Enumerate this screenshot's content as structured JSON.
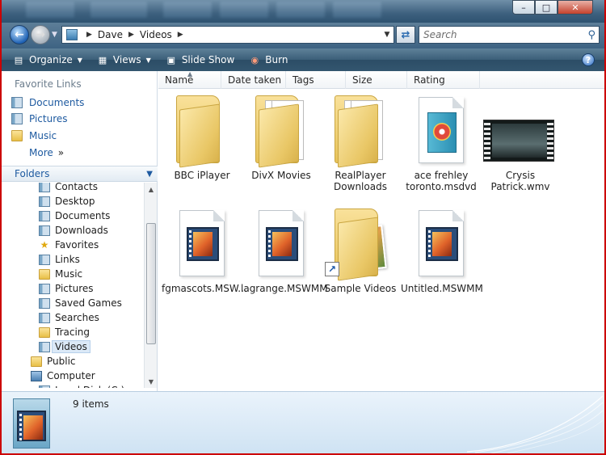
{
  "address": {
    "crumbs": [
      "Dave",
      "Videos"
    ],
    "search_placeholder": "Search"
  },
  "toolbar": {
    "organize": "Organize",
    "views": "Views",
    "slideshow": "Slide Show",
    "burn": "Burn"
  },
  "nav": {
    "favorites_title": "Favorite Links",
    "favorites": [
      "Documents",
      "Pictures",
      "Music"
    ],
    "more": "More",
    "folders_title": "Folders",
    "tree": [
      {
        "label": "Contacts",
        "icon": "lib"
      },
      {
        "label": "Desktop",
        "icon": "lib"
      },
      {
        "label": "Documents",
        "icon": "lib"
      },
      {
        "label": "Downloads",
        "icon": "lib"
      },
      {
        "label": "Favorites",
        "icon": "star"
      },
      {
        "label": "Links",
        "icon": "lib"
      },
      {
        "label": "Music",
        "icon": "folder"
      },
      {
        "label": "Pictures",
        "icon": "lib"
      },
      {
        "label": "Saved Games",
        "icon": "lib"
      },
      {
        "label": "Searches",
        "icon": "lib"
      },
      {
        "label": "Tracing",
        "icon": "folder"
      },
      {
        "label": "Videos",
        "icon": "lib",
        "selected": true
      },
      {
        "label": "Public",
        "icon": "folder"
      },
      {
        "label": "Computer",
        "icon": "pc"
      },
      {
        "label": "Local Disk (C:)",
        "icon": "lib"
      }
    ]
  },
  "columns": [
    "Name",
    "Date taken",
    "Tags",
    "Size",
    "Rating"
  ],
  "items": [
    {
      "name": "BBC iPlayer",
      "kind": "folder"
    },
    {
      "name": "DivX Movies",
      "kind": "folder-papers"
    },
    {
      "name": "RealPlayer Downloads",
      "kind": "folder-papers"
    },
    {
      "name": "ace frehley toronto.msdvd",
      "kind": "dvd"
    },
    {
      "name": "Crysis Patrick.wmv",
      "kind": "video"
    },
    {
      "name": "fgmascots.MSW...",
      "kind": "mswmm"
    },
    {
      "name": "lagrange.MSWMM",
      "kind": "mswmm"
    },
    {
      "name": "Sample Videos",
      "kind": "folder-shortcut"
    },
    {
      "name": "Untitled.MSWMM",
      "kind": "mswmm"
    }
  ],
  "details": {
    "count": "9 items"
  },
  "colors": {
    "link": "#1e5aa0",
    "selection": "#dbe9f7",
    "frame": "#cc0000"
  }
}
